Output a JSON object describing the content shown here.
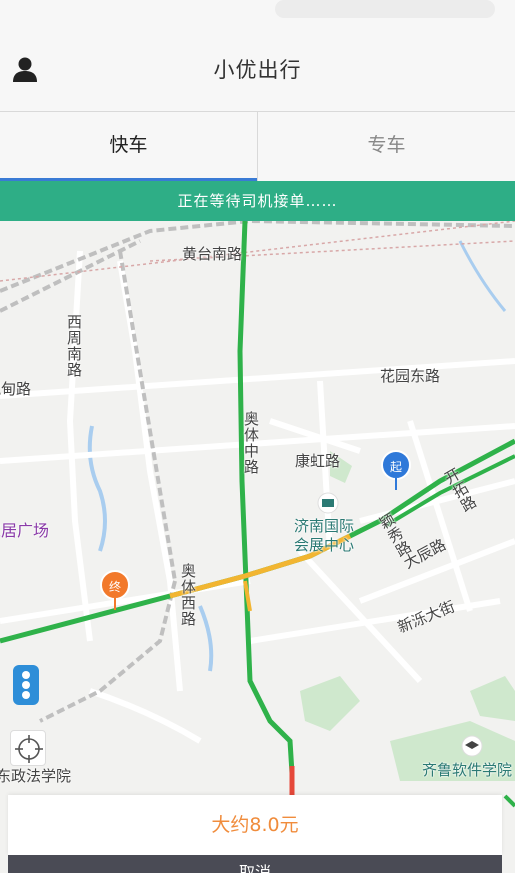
{
  "header": {
    "title": "小优出行",
    "user_icon": "user-icon"
  },
  "tabs": [
    {
      "label": "快车",
      "active": true
    },
    {
      "label": "专车",
      "active": false
    }
  ],
  "banner": {
    "text": "正在等待司机接单……"
  },
  "map": {
    "labels": {
      "huangtai": "黄台南路",
      "xizhou": "西周南路",
      "kuangdian": "祝甸路",
      "huayuan": "花园东路",
      "aoti_zhong": "奥体中路",
      "kanghong": "康虹路",
      "jiajuguangchang": "家居广场",
      "huizhan": "济南国际会展中心",
      "yingxiu": "颖秀路",
      "kaituo": "开拓路",
      "dachen": "大辰路",
      "aoti_xi": "奥体西路",
      "xinluo": "新泺大街",
      "zhengfa": "东政法学院",
      "qilu": "齐鲁软件学院"
    },
    "start_marker": "起",
    "end_marker": "终",
    "colors": {
      "road_green": "#2fb24a",
      "road_yellow": "#f2b531",
      "road_red": "#e5483a",
      "start_blue": "#2f79d9",
      "end_orange": "#f2792b",
      "banner": "#2eae86"
    }
  },
  "controls": {
    "traffic_icon": "traffic-light-icon",
    "locate_icon": "crosshair-icon"
  },
  "fare": {
    "text": "大约8.0元"
  },
  "bottom_button": {
    "label": "取消"
  }
}
